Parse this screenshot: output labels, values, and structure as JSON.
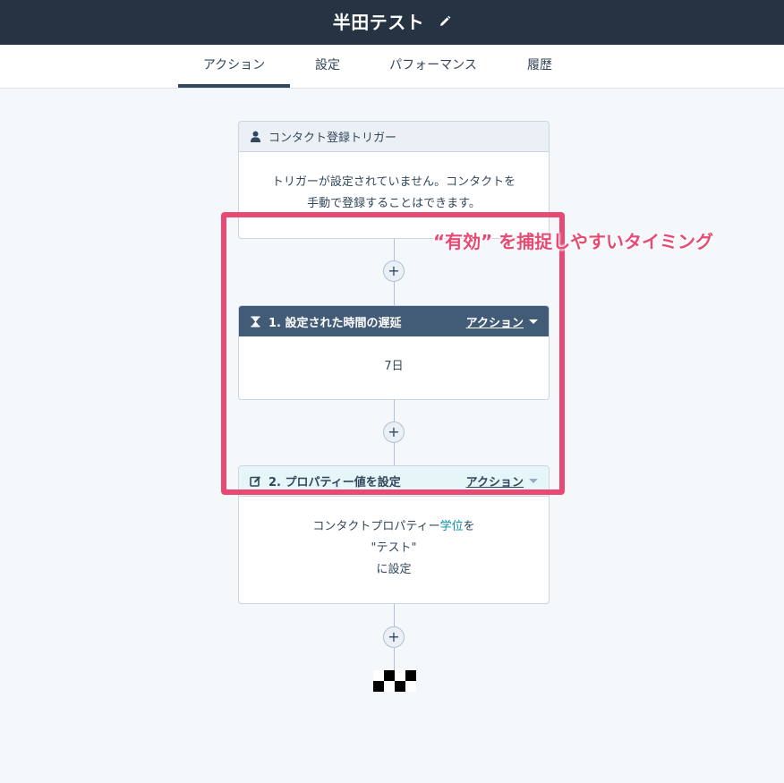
{
  "header": {
    "title": "半田テスト",
    "edit_icon": "pencil-icon"
  },
  "tabs": [
    {
      "label": "アクション",
      "active": true
    },
    {
      "label": "設定",
      "active": false
    },
    {
      "label": "パフォーマンス",
      "active": false
    },
    {
      "label": "履歴",
      "active": false
    }
  ],
  "trigger": {
    "icon": "person-icon",
    "title": "コンタクト登録トリガー",
    "body_line1": "トリガーが設定されていません。コンタクトを",
    "body_line2": "手動で登録することはできます。"
  },
  "steps": [
    {
      "icon": "hourglass-icon",
      "title": "1. 設定された時間の遅延",
      "action_label": "アクション",
      "body": "7日"
    },
    {
      "icon": "edit-property-icon",
      "title": "2. プロパティー値を設定",
      "action_label": "アクション",
      "body_prefix": "コンタクトプロパティー",
      "body_property": "学位",
      "body_suffix": "を",
      "body_value": "\"テスト\"",
      "body_line3": "に設定"
    }
  ],
  "add_button_label": "+",
  "annotation": {
    "text": "“有効” を捕捉しやすいタイミング",
    "color": "#e84a73"
  },
  "colors": {
    "topbar": "#253342",
    "dark_header": "#425b76",
    "link": "#0091ae",
    "accent": "#e84a73"
  }
}
